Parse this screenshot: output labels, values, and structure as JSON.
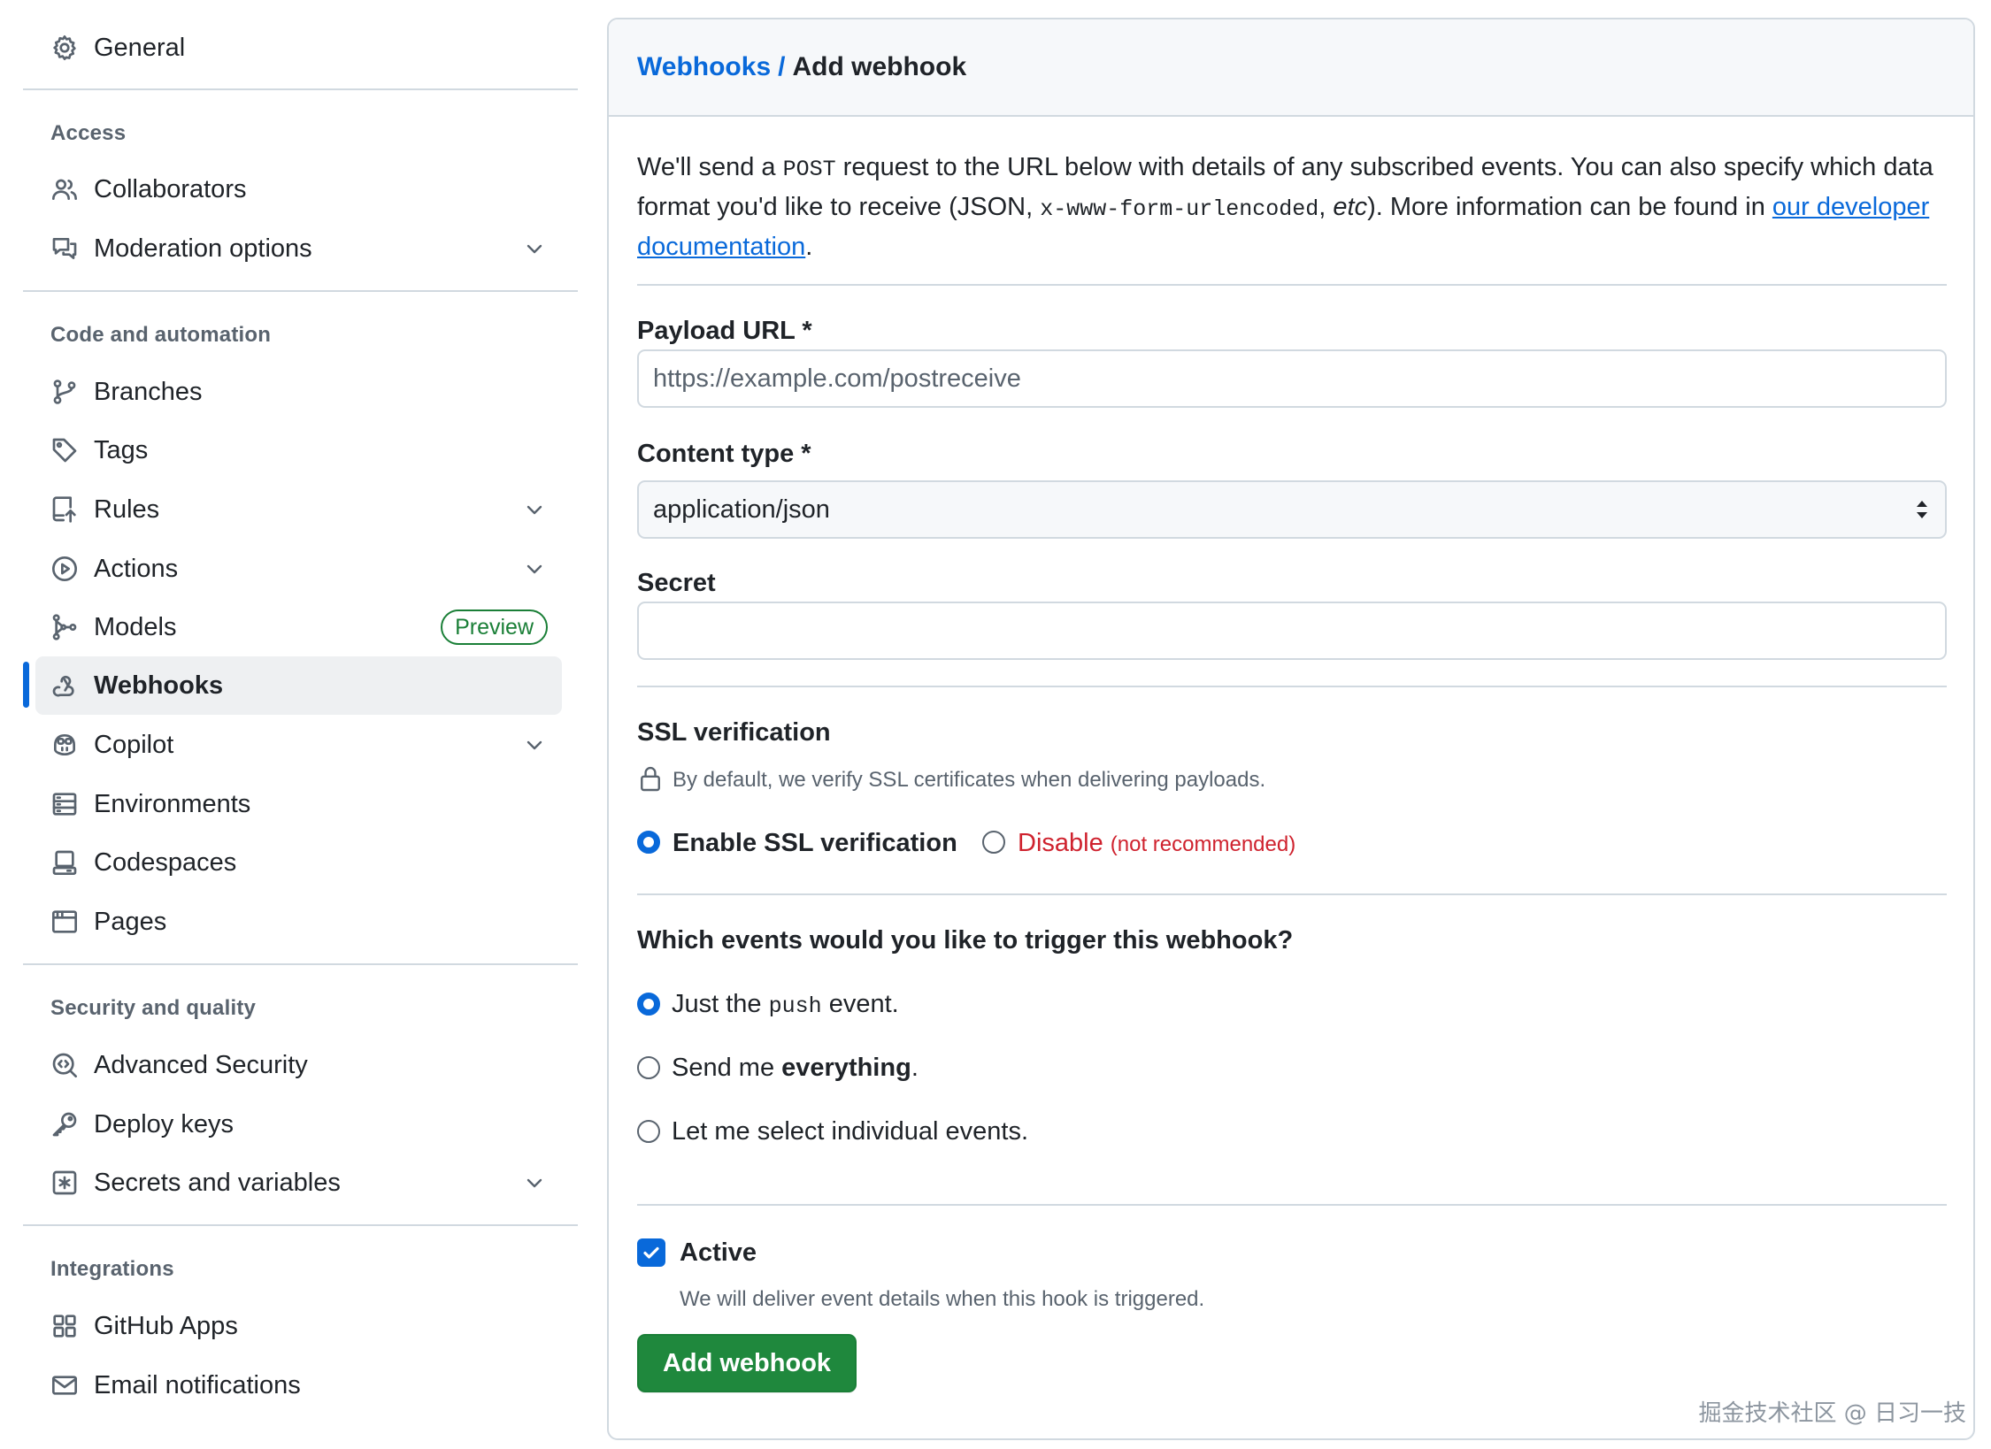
{
  "sidebar": {
    "general": "General",
    "sections": {
      "access": "Access",
      "code": "Code and automation",
      "security": "Security and quality",
      "integrations": "Integrations"
    },
    "items": {
      "collaborators": "Collaborators",
      "moderation": "Moderation options",
      "branches": "Branches",
      "tags": "Tags",
      "rules": "Rules",
      "actions": "Actions",
      "models": "Models",
      "models_badge": "Preview",
      "webhooks": "Webhooks",
      "copilot": "Copilot",
      "environments": "Environments",
      "codespaces": "Codespaces",
      "pages": "Pages",
      "advanced_security": "Advanced Security",
      "deploy_keys": "Deploy keys",
      "secrets": "Secrets and variables",
      "github_apps": "GitHub Apps",
      "email_notifications": "Email notifications"
    },
    "active_item": "Webhooks"
  },
  "header": {
    "breadcrumb_parent": "Webhooks",
    "breadcrumb_sep": "/",
    "breadcrumb_current": "Add webhook"
  },
  "intro": {
    "p1": "We'll send a ",
    "code1": "POST",
    "p2": " request to the URL below with details of any subscribed events. You can also specify which data format you'd like to receive (JSON, ",
    "code2": "x-www-form-urlencoded",
    "p3": ", ",
    "em": "etc",
    "p4": "). More information can be found in ",
    "link": "our developer documentation",
    "p5": "."
  },
  "form": {
    "payload_label": "Payload URL *",
    "payload_placeholder": "https://example.com/postreceive",
    "payload_value": "",
    "content_type_label": "Content type *",
    "content_type_value": "application/json",
    "secret_label": "Secret",
    "secret_value": ""
  },
  "ssl": {
    "title": "SSL verification",
    "note": "By default, we verify SSL certificates when delivering payloads.",
    "enable_label": "Enable SSL verification",
    "disable_label": "Disable",
    "disable_note": "(not recommended)",
    "selected": "enable"
  },
  "events": {
    "title": "Which events would you like to trigger this webhook?",
    "opt1_pre": "Just the ",
    "opt1_code": "push",
    "opt1_post": " event.",
    "opt2_pre": "Send me ",
    "opt2_bold": "everything",
    "opt2_post": ".",
    "opt3": "Let me select individual events.",
    "selected": "push"
  },
  "active": {
    "label": "Active",
    "checked": true,
    "note": "We will deliver event details when this hook is triggered."
  },
  "submit_label": "Add webhook",
  "watermark": "掘金技术社区 @ 日习一技",
  "colors": {
    "accent": "#0969da",
    "success": "#1f883d",
    "danger": "#cf222e",
    "border": "#d1d9e0"
  }
}
